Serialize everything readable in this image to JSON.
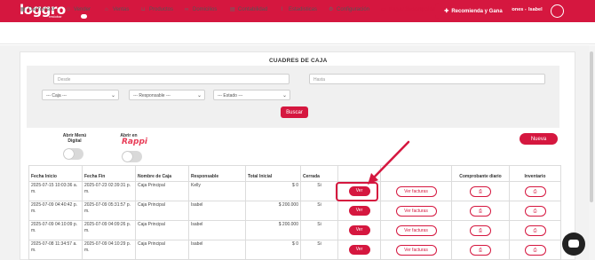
{
  "brand": {
    "logo": "loggro",
    "logo_sub": "restobar"
  },
  "topbar": {
    "company": "Capacitaciones -",
    "user": "Isabel"
  },
  "nav": {
    "items": [
      {
        "icon": "grid-icon",
        "label": "Dashboard"
      },
      {
        "icon": "user-icon",
        "label": "Vender"
      },
      {
        "icon": "tag-icon",
        "label": "Ventas"
      },
      {
        "icon": "basket-icon",
        "label": "Productos"
      },
      {
        "icon": "bike-icon",
        "label": "Domicilios"
      },
      {
        "icon": "calculator-icon",
        "label": "Contabilidad"
      },
      {
        "icon": "chart-icon",
        "label": "Estadisticas"
      },
      {
        "icon": "gear-icon",
        "label": "Configuración"
      },
      {
        "icon": "card-icon",
        "label": "Pagar Suscripción"
      }
    ],
    "cta": "Recomienda y Gana"
  },
  "page": {
    "title": "CUADRES DE CAJA",
    "filters": {
      "desde_placeholder": "Desde",
      "hasta_placeholder": "Hasta",
      "caja": "--- Caja ---",
      "responsable": "--- Responsable ---",
      "estado": "--- Estado ---",
      "search_label": "Buscar"
    },
    "toggles": {
      "menu_digital": "Abrir Menú Digital",
      "rappi_label": "Abrir en",
      "rappi_brand": "Rappi"
    },
    "new_label": "Nueva"
  },
  "table": {
    "headers": [
      "Fecha Inicio",
      "Fecha Fin",
      "Nombre de Caja",
      "Responsable",
      "Total Inicial",
      "Cerrada",
      "",
      "",
      "Comprobante diario",
      "Inventario"
    ],
    "rows": [
      {
        "inicio": "2025-07-15 10:03:36 a. m.",
        "fin": "2025-07-23 02:39:31 p. m.",
        "caja": "Caja Principal",
        "responsable": "Kelly",
        "total": "$ 0",
        "cerrada": "Si",
        "ver": "Ver",
        "facturas": "Ver facturas"
      },
      {
        "inicio": "2025-07-09 04:40:42 p. m.",
        "fin": "2025-07-09 05:31:57 p. m.",
        "caja": "Caja Principal",
        "responsable": "Isabel",
        "total": "$ 200.000",
        "cerrada": "Si",
        "ver": "Ver",
        "facturas": "Ver facturas"
      },
      {
        "inicio": "2025-07-09 04:10:09 p. m.",
        "fin": "2025-07-09 04:09:26 p. m.",
        "caja": "Caja Principal",
        "responsable": "Isabel",
        "total": "$ 200.000",
        "cerrada": "Si",
        "ver": "Ver",
        "facturas": "Ver facturas"
      },
      {
        "inicio": "2025-07-08 11:34:57 a. m.",
        "fin": "2025-07-09 04:10:29 p. m.",
        "caja": "Caja Principal",
        "responsable": "Isabel",
        "total": "$ 0",
        "cerrada": "Si",
        "ver": "Ver",
        "facturas": "Ver facturas"
      }
    ]
  },
  "colors": {
    "brand": "#d5173f",
    "background": "#f2f2f2"
  }
}
